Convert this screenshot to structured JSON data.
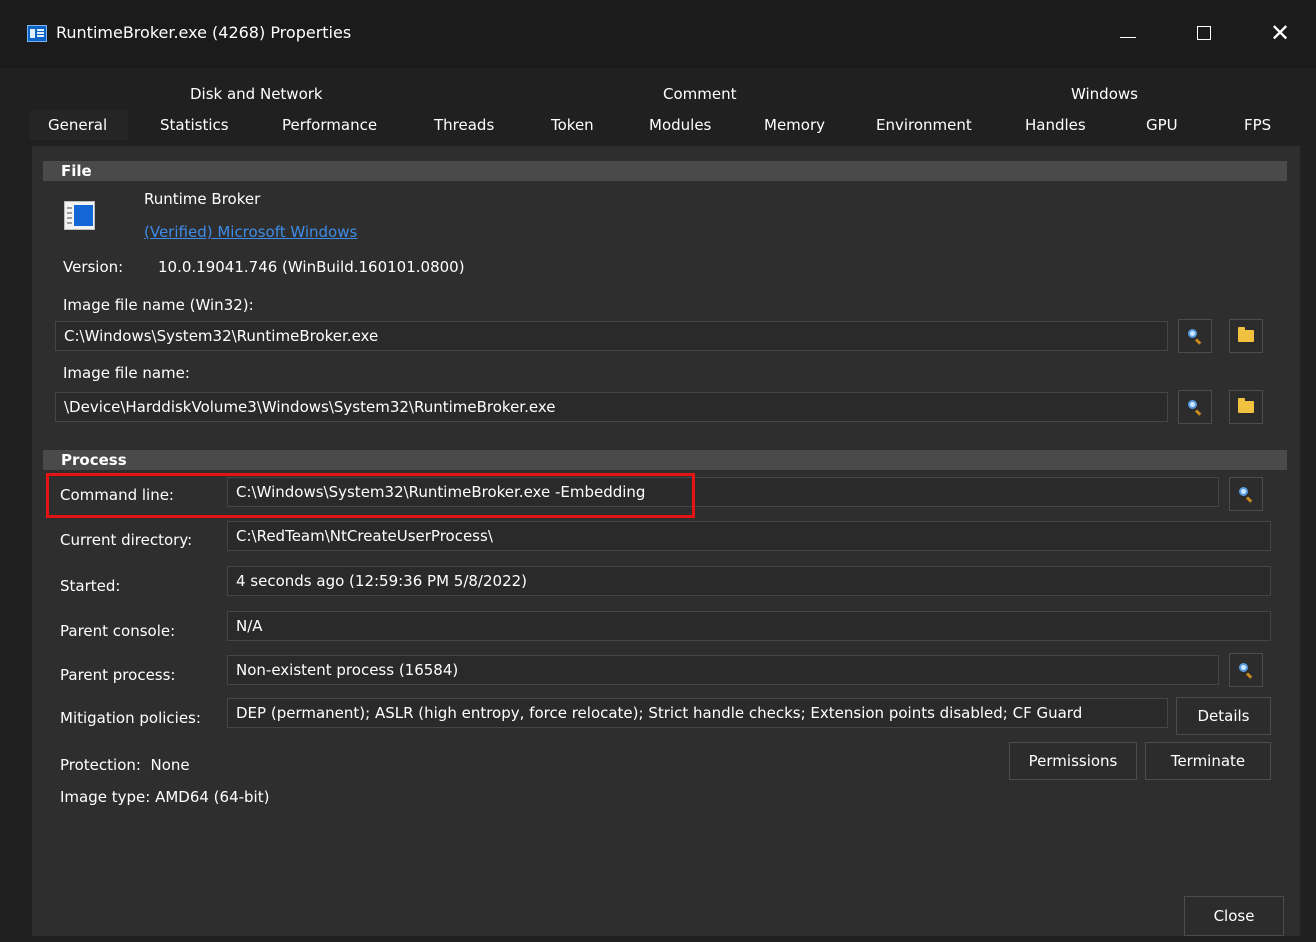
{
  "window": {
    "title": "RuntimeBroker.exe (4268) Properties",
    "icon": "window-app-icon"
  },
  "tabs": {
    "upper": [
      {
        "label": "Disk and Network"
      },
      {
        "label": "Comment"
      },
      {
        "label": "Windows"
      }
    ],
    "lower": [
      {
        "label": "General",
        "selected": true
      },
      {
        "label": "Statistics"
      },
      {
        "label": "Performance"
      },
      {
        "label": "Threads"
      },
      {
        "label": "Token"
      },
      {
        "label": "Modules"
      },
      {
        "label": "Memory"
      },
      {
        "label": "Environment"
      },
      {
        "label": "Handles"
      },
      {
        "label": "GPU"
      },
      {
        "label": "FPS"
      }
    ]
  },
  "file": {
    "header": "File",
    "description": "Runtime Broker",
    "verified_link": "(Verified) Microsoft Windows",
    "version_label": "Version:",
    "version_value": "10.0.19041.746 (WinBuild.160101.0800)",
    "image_win32_label": "Image file name (Win32):",
    "image_win32_value": "C:\\Windows\\System32\\RuntimeBroker.exe",
    "image_name_label": "Image file name:",
    "image_name_value": "\\Device\\HarddiskVolume3\\Windows\\System32\\RuntimeBroker.exe"
  },
  "process": {
    "header": "Process",
    "command_line_label": "Command line:",
    "command_line_value": "C:\\Windows\\System32\\RuntimeBroker.exe -Embedding",
    "current_dir_label": "Current directory:",
    "current_dir_value": "C:\\RedTeam\\NtCreateUserProcess\\",
    "started_label": "Started:",
    "started_value": "4 seconds ago (12:59:36 PM 5/8/2022)",
    "parent_console_label": "Parent console:",
    "parent_console_value": "N/A",
    "parent_process_label": "Parent process:",
    "parent_process_value": "Non-existent process (16584)",
    "mitigation_label": "Mitigation policies:",
    "mitigation_value": "DEP (permanent); ASLR (high entropy, force relocate); Strict handle checks; Extension points disabled; CF Guard",
    "details_button": "Details",
    "permissions_button": "Permissions",
    "terminate_button": "Terminate",
    "protection_text": "Protection:  None",
    "image_type_text": "Image type: AMD64 (64-bit)"
  },
  "footer": {
    "close_button": "Close"
  },
  "colors": {
    "background": "#202020",
    "panel": "#2e2e2e",
    "section_header": "#4a4a4a",
    "link": "#3f8ce8",
    "highlight": "#e41414"
  }
}
